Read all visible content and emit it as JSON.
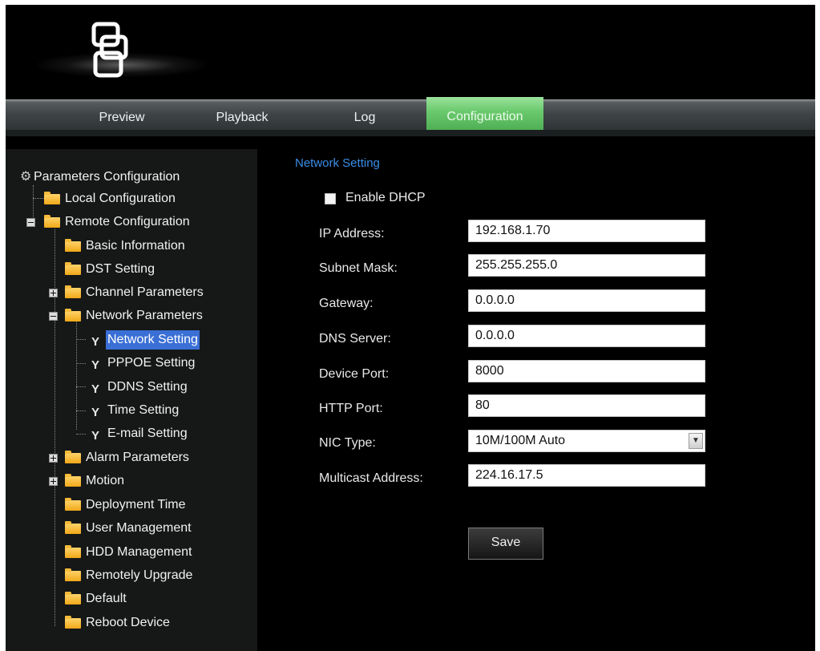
{
  "nav": {
    "tabs": [
      {
        "label": "Preview"
      },
      {
        "label": "Playback"
      },
      {
        "label": "Log"
      },
      {
        "label": "Configuration",
        "active": true
      }
    ]
  },
  "tree": {
    "root": "Parameters Configuration",
    "local": "Local Configuration",
    "remote": "Remote Configuration",
    "basic_information": "Basic Information",
    "dst_setting": "DST Setting",
    "channel_parameters": "Channel Parameters",
    "network_parameters": "Network Parameters",
    "network_setting": "Network Setting",
    "pppoe_setting": "PPPOE Setting",
    "ddns_setting": "DDNS Setting",
    "time_setting": "Time Setting",
    "email_setting": "E-mail Setting",
    "alarm_parameters": "Alarm Parameters",
    "motion": "Motion",
    "deployment_time": "Deployment Time",
    "user_management": "User Management",
    "hdd_management": "HDD Management",
    "remotely_upgrade": "Remotely Upgrade",
    "default": "Default",
    "reboot_device": "Reboot Device"
  },
  "content": {
    "section_title": "Network Setting",
    "enable_dhcp_label": "Enable DHCP",
    "enable_dhcp_checked": false,
    "ip_address_label": "IP Address:",
    "ip_address_value": "192.168.1.70",
    "subnet_mask_label": "Subnet Mask:",
    "subnet_mask_value": "255.255.255.0",
    "gateway_label": "Gateway:",
    "gateway_value": "0.0.0.0",
    "dns_server_label": "DNS Server:",
    "dns_server_value": "0.0.0.0",
    "device_port_label": "Device Port:",
    "device_port_value": "8000",
    "http_port_label": "HTTP Port:",
    "http_port_value": "80",
    "nic_type_label": "NIC Type:",
    "nic_type_value": "10M/100M Auto",
    "multicast_address_label": "Multicast Address:",
    "multicast_address_value": "224.16.17.5",
    "save_label": "Save"
  },
  "colors": {
    "active_tab": "#6ccb6f",
    "section_title": "#3a8ee8",
    "selection": "#3a6fd6"
  }
}
